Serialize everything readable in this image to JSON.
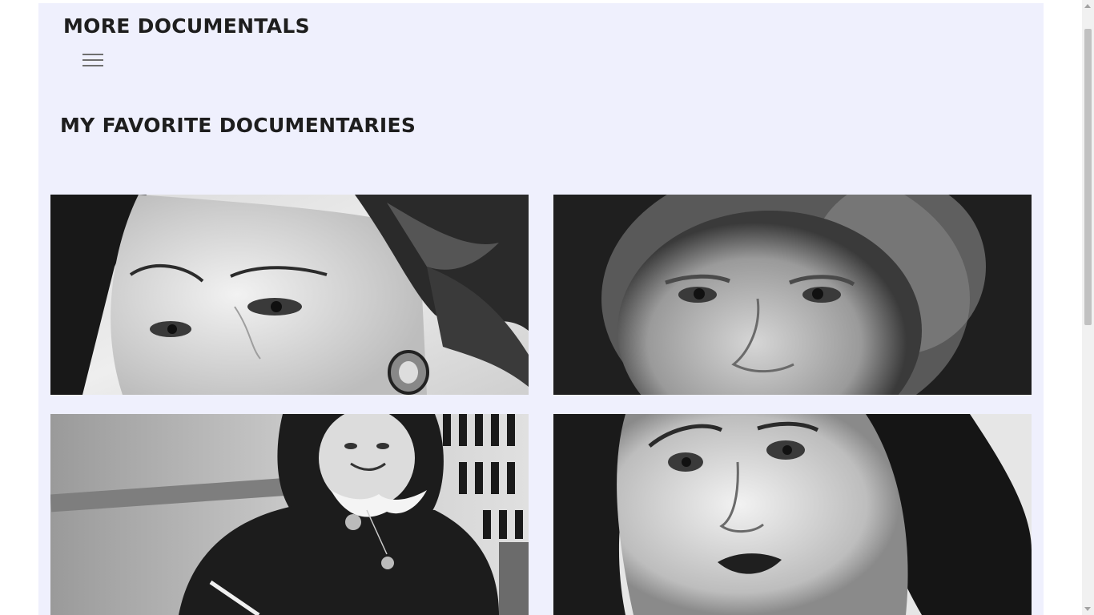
{
  "header": {
    "brand": "MORE DOCUMENTALS",
    "menu_icon": "hamburger-menu-icon"
  },
  "main": {
    "section_title": "MY FAVORITE DOCUMENTARIES",
    "documentaries": [
      {
        "image": "black-and-white portrait, close-up of woman with dark wavy hair and earring"
      },
      {
        "image": "black-and-white portrait of older woman with grey hair"
      },
      {
        "image": "black-and-white photo of smiling girl with white collar writing at desk"
      },
      {
        "image": "black-and-white portrait of woman with dark hair and dark lips"
      }
    ]
  },
  "colors": {
    "page_background": "#eff0fd",
    "heading_text": "#1e1e1e"
  }
}
